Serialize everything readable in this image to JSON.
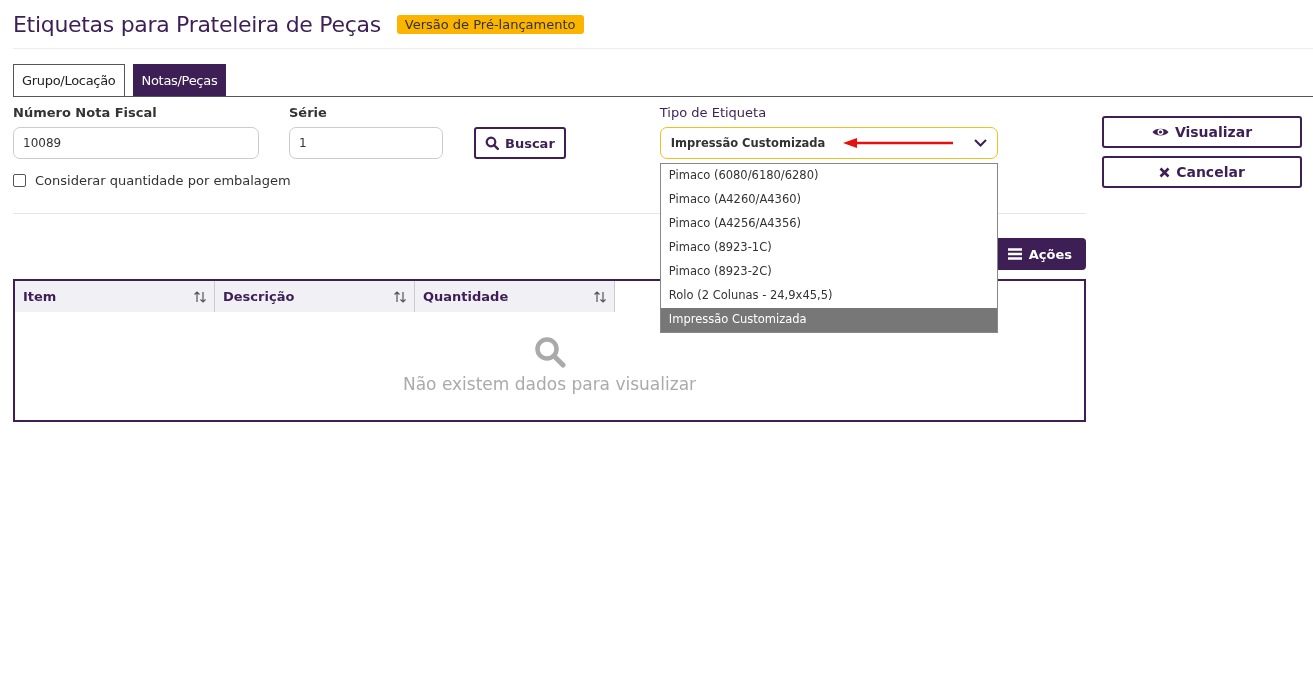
{
  "page_title": "Etiquetas para Prateleira de Peças",
  "badge": "Versão de Pré-lançamento",
  "tabs": [
    {
      "label": "Grupo/Locação",
      "selected": false
    },
    {
      "label": "Notas/Peças",
      "selected": true
    }
  ],
  "form": {
    "invoice_number": {
      "label": "Número Nota Fiscal",
      "value": "10089"
    },
    "series": {
      "label": "Série",
      "value": "1"
    },
    "search_button": "Buscar",
    "package_quantity": {
      "label": "Considerar quantidade por embalagem",
      "checked": false
    },
    "label_type": {
      "label": "Tipo de Etiqueta",
      "value": "Impressão Customizada",
      "expanded": true,
      "options": [
        {
          "label": "Pimaco (6080/6180/6280)",
          "selected": false
        },
        {
          "label": "Pimaco (A4260/A4360)",
          "selected": false
        },
        {
          "label": "Pimaco (A4256/A4356)",
          "selected": false
        },
        {
          "label": "Pimaco (8923-1C)",
          "selected": false
        },
        {
          "label": "Pimaco (8923-2C)",
          "selected": false
        },
        {
          "label": "Rolo (2 Colunas - 24,9x45,5)",
          "selected": false
        },
        {
          "label": "Impressão Customizada",
          "selected": true
        }
      ]
    }
  },
  "actions_button": "Ações",
  "table": {
    "columns": [
      "Item",
      "Descrição",
      "Quantidade"
    ],
    "empty_message": "Não existem dados para visualizar"
  },
  "side_buttons": [
    "Visualizar",
    "Cancelar"
  ]
}
